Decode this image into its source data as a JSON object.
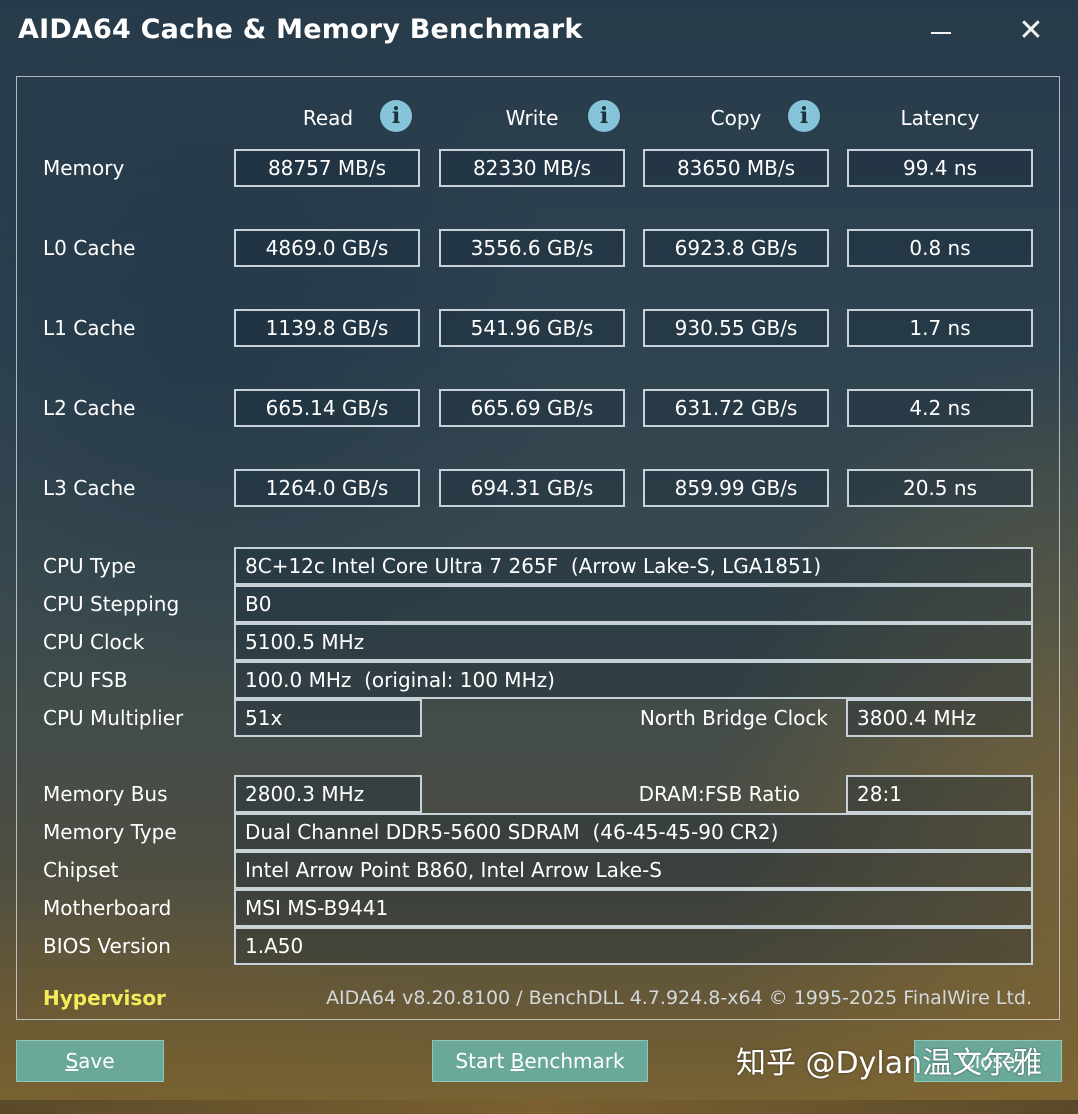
{
  "window": {
    "title": "AIDA64 Cache & Memory Benchmark",
    "minimize_glyph": "—",
    "close_glyph": "✕"
  },
  "columns": [
    "Read",
    "Write",
    "Copy",
    "Latency"
  ],
  "benchmark": {
    "rows": [
      {
        "label": "Memory",
        "values": [
          "88757 MB/s",
          "82330 MB/s",
          "83650 MB/s",
          "99.4 ns"
        ]
      },
      {
        "label": "L0 Cache",
        "values": [
          "4869.0 GB/s",
          "3556.6 GB/s",
          "6923.8 GB/s",
          "0.8 ns"
        ]
      },
      {
        "label": "L1 Cache",
        "values": [
          "1139.8 GB/s",
          "541.96 GB/s",
          "930.55 GB/s",
          "1.7 ns"
        ]
      },
      {
        "label": "L2 Cache",
        "values": [
          "665.14 GB/s",
          "665.69 GB/s",
          "631.72 GB/s",
          "4.2 ns"
        ]
      },
      {
        "label": "L3 Cache",
        "values": [
          "1264.0 GB/s",
          "694.31 GB/s",
          "859.99 GB/s",
          "20.5 ns"
        ]
      }
    ]
  },
  "info": {
    "cpu_type": {
      "label": "CPU Type",
      "value": "8C+12c Intel Core Ultra 7 265F  (Arrow Lake-S, LGA1851)"
    },
    "cpu_stepping": {
      "label": "CPU Stepping",
      "value": "B0"
    },
    "cpu_clock": {
      "label": "CPU Clock",
      "value": "5100.5 MHz"
    },
    "cpu_fsb": {
      "label": "CPU FSB",
      "value": "100.0 MHz  (original: 100 MHz)"
    },
    "cpu_multiplier": {
      "label": "CPU Multiplier",
      "value": "51x"
    },
    "north_bridge": {
      "label": "North Bridge Clock",
      "value": "3800.4 MHz"
    },
    "memory_bus": {
      "label": "Memory Bus",
      "value": "2800.3 MHz"
    },
    "dram_fsb": {
      "label": "DRAM:FSB Ratio",
      "value": "28:1"
    },
    "memory_type": {
      "label": "Memory Type",
      "value": "Dual Channel DDR5-5600 SDRAM  (46-45-45-90 CR2)"
    },
    "chipset": {
      "label": "Chipset",
      "value": "Intel Arrow Point B860, Intel Arrow Lake-S"
    },
    "motherboard": {
      "label": "Motherboard",
      "value": "MSI MS-B9441"
    },
    "bios": {
      "label": "BIOS Version",
      "value": "1.A50"
    }
  },
  "footer": {
    "hypervisor": "Hypervisor",
    "version": "AIDA64 v8.20.8100 / BenchDLL 4.7.924.8-x64 © 1995-2025 FinalWire Ltd."
  },
  "buttons": {
    "save_first": "S",
    "save_rest": "ave",
    "start_first": "Start ",
    "start_ul": "B",
    "start_rest": "enchmark",
    "close": "Close"
  },
  "watermark": "知乎 @Dylan温文尔雅",
  "colors": {
    "button_bg": "#6aa999",
    "hypervisor": "#f4ec5a",
    "info_icon": "#86c4da"
  }
}
